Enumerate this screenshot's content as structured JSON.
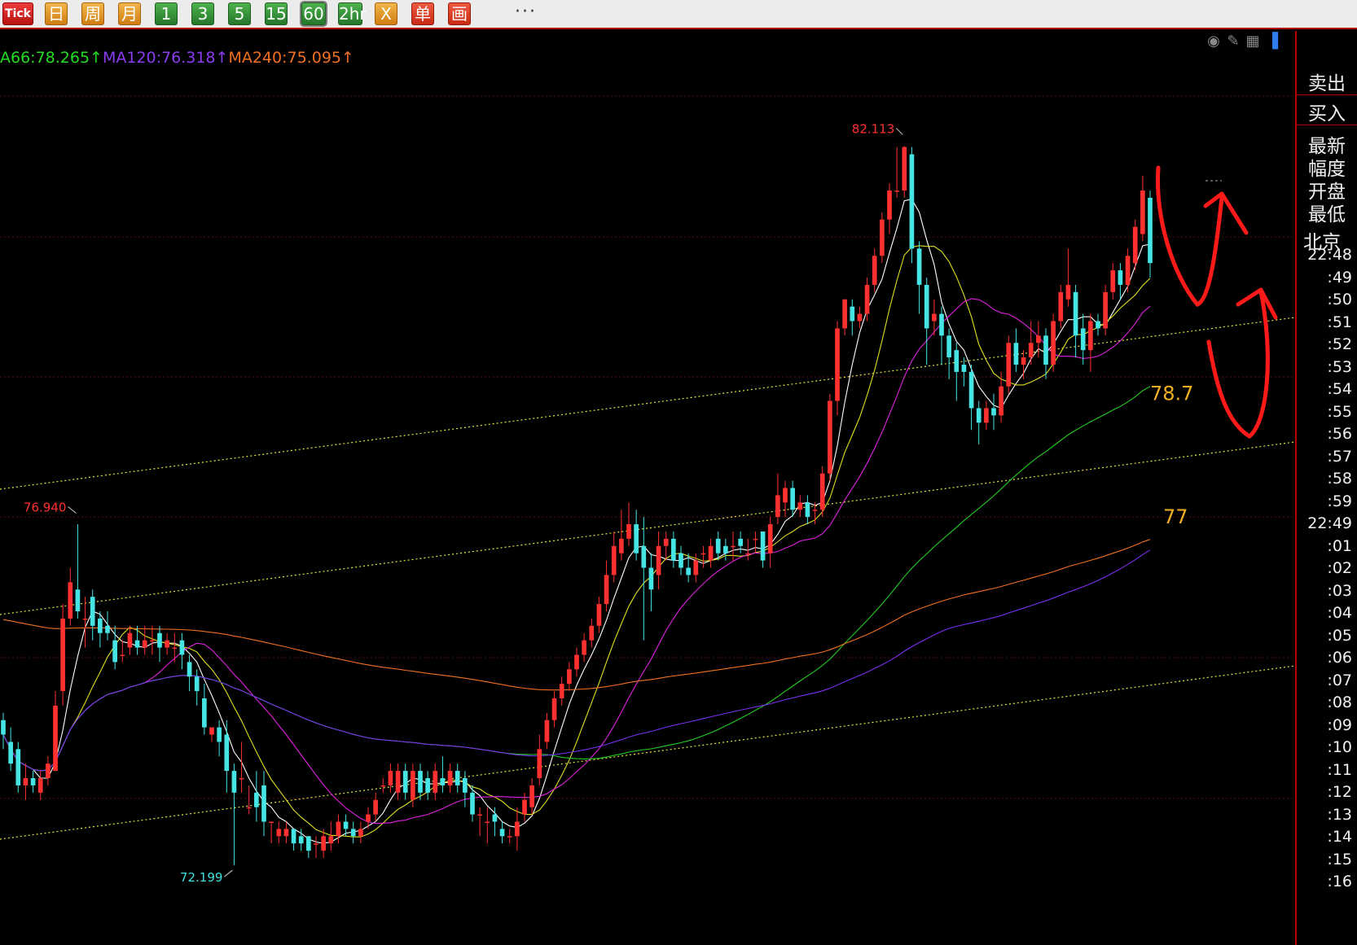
{
  "toolbar": {
    "buttons": [
      {
        "label": "Tick",
        "style": "tick"
      },
      {
        "label": "日",
        "style": "gold"
      },
      {
        "label": "周",
        "style": "gold"
      },
      {
        "label": "月",
        "style": "gold"
      },
      {
        "label": "1",
        "style": "green"
      },
      {
        "label": "3",
        "style": "green"
      },
      {
        "label": "5",
        "style": "green"
      },
      {
        "label": "15",
        "style": "green"
      },
      {
        "label": "60",
        "style": "green-selected"
      },
      {
        "label": "2hr",
        "style": "green"
      },
      {
        "label": "X",
        "style": "gold"
      },
      {
        "label": "单",
        "style": "red"
      },
      {
        "label": "画",
        "style": "red"
      }
    ],
    "more_label": "···"
  },
  "ma_legend": {
    "ma66": {
      "text": "A66:78.265↑",
      "color": "#22dd22"
    },
    "ma120": {
      "text": "MA120:76.318↑",
      "color": "#8a3cf0"
    },
    "ma240": {
      "text": "MA240:75.095↑",
      "color": "#f07020"
    }
  },
  "chart_data": {
    "type": "candlestick",
    "price_range": [
      71.1,
      83.7
    ],
    "annotations": [
      {
        "text": "82.113",
        "value": 82.113,
        "color": "#ff3030"
      },
      {
        "text": "76.940",
        "value": 76.94,
        "color": "#ff3030"
      },
      {
        "text": "72.199",
        "value": 72.199,
        "color": "#40e0e0"
      },
      {
        "text": "78.7",
        "value": 78.7,
        "color": "#f0b020"
      },
      {
        "text": "77",
        "value": 77,
        "color": "#f0b020"
      }
    ],
    "colors": {
      "up": "#ff3030",
      "down": "#45e5e5",
      "ma_fast": "#ffffff",
      "ma_mid": "#e0e020",
      "ma_slow": "#e020e0",
      "ma66": "#22cc22",
      "ma120": "#7a30f0",
      "ma240": "#f07020",
      "trend": "#e6e640",
      "hand_drawn": "#ff1a1a"
    },
    "candles": [
      [
        74.2,
        74.0,
        74.3,
        73.8
      ],
      [
        73.9,
        73.6,
        74.1,
        73.5
      ],
      [
        73.8,
        73.3,
        73.9,
        73.2
      ],
      [
        73.3,
        73.4,
        73.6,
        73.1
      ],
      [
        73.4,
        73.3,
        73.5,
        73.2
      ],
      [
        73.2,
        73.4,
        73.5,
        73.1
      ],
      [
        73.4,
        73.6,
        73.7,
        73.3
      ],
      [
        73.5,
        74.4,
        74.6,
        73.5
      ],
      [
        74.6,
        75.6,
        75.8,
        74.4
      ],
      [
        75.6,
        76.1,
        76.3,
        75.5
      ],
      [
        76.0,
        75.7,
        76.9,
        75.6
      ],
      [
        75.6,
        75.6,
        75.9,
        75.2
      ],
      [
        75.9,
        75.5,
        76.0,
        75.3
      ],
      [
        75.6,
        75.4,
        75.7,
        75.2
      ],
      [
        75.5,
        75.4,
        75.7,
        75.3
      ],
      [
        75.3,
        75.0,
        75.5,
        74.9
      ],
      [
        75.1,
        75.1,
        75.3,
        75.0
      ],
      [
        75.2,
        75.4,
        75.5,
        75.1
      ],
      [
        75.3,
        75.2,
        75.5,
        75.1
      ],
      [
        75.2,
        75.3,
        75.5,
        75.1
      ],
      [
        75.3,
        75.3,
        75.5,
        75.1
      ],
      [
        75.4,
        75.2,
        75.5,
        75.0
      ],
      [
        75.2,
        75.3,
        75.4,
        75.1
      ],
      [
        75.2,
        75.2,
        75.4,
        75.0
      ],
      [
        75.3,
        75.1,
        75.4,
        74.9
      ],
      [
        75.0,
        74.8,
        75.1,
        74.6
      ],
      [
        74.8,
        74.6,
        74.9,
        74.4
      ],
      [
        74.5,
        74.1,
        74.7,
        74.0
      ],
      [
        74.0,
        74.1,
        74.1,
        73.9
      ],
      [
        74.1,
        73.9,
        74.2,
        73.7
      ],
      [
        74.0,
        73.5,
        74.2,
        73.2
      ],
      [
        73.5,
        73.2,
        73.6,
        72.2
      ],
      [
        73.4,
        73.4,
        73.9,
        73.2
      ],
      [
        73.0,
        73.0,
        73.3,
        72.9
      ],
      [
        73.2,
        73.0,
        73.5,
        72.8
      ],
      [
        73.3,
        72.8,
        73.5,
        72.6
      ],
      [
        72.8,
        72.8,
        72.8,
        72.5
      ],
      [
        72.6,
        72.7,
        72.8,
        72.5
      ],
      [
        72.6,
        72.7,
        72.8,
        72.5
      ],
      [
        72.7,
        72.5,
        72.7,
        72.4
      ],
      [
        72.6,
        72.5,
        72.7,
        72.4
      ],
      [
        72.6,
        72.4,
        72.6,
        72.3
      ],
      [
        72.5,
        72.5,
        72.6,
        72.3
      ],
      [
        72.4,
        72.6,
        72.7,
        72.3
      ],
      [
        72.5,
        72.6,
        72.8,
        72.4
      ],
      [
        72.6,
        72.8,
        72.9,
        72.5
      ],
      [
        72.8,
        72.7,
        72.9,
        72.6
      ],
      [
        72.7,
        72.6,
        72.8,
        72.5
      ],
      [
        72.6,
        72.7,
        72.8,
        72.5
      ],
      [
        72.8,
        72.9,
        73.0,
        72.7
      ],
      [
        72.9,
        73.1,
        73.2,
        72.8
      ],
      [
        73.3,
        73.3,
        73.4,
        73.2
      ],
      [
        73.3,
        73.5,
        73.6,
        73.2
      ],
      [
        73.2,
        73.5,
        73.6,
        73.1
      ],
      [
        73.5,
        73.2,
        73.6,
        73.1
      ],
      [
        73.1,
        73.5,
        73.6,
        73.0
      ],
      [
        73.5,
        73.2,
        73.6,
        73.1
      ],
      [
        73.4,
        73.2,
        73.5,
        73.1
      ],
      [
        73.2,
        73.5,
        73.6,
        73.1
      ],
      [
        73.4,
        73.3,
        73.7,
        73.2
      ],
      [
        73.3,
        73.5,
        73.6,
        73.2
      ],
      [
        73.5,
        73.3,
        73.6,
        73.2
      ],
      [
        73.4,
        73.2,
        73.5,
        73.0
      ],
      [
        73.2,
        72.9,
        73.3,
        72.8
      ],
      [
        72.9,
        72.9,
        73.0,
        72.6
      ],
      [
        72.8,
        72.8,
        73.0,
        72.5
      ],
      [
        72.9,
        72.8,
        73.0,
        72.6
      ],
      [
        72.7,
        72.6,
        72.8,
        72.5
      ],
      [
        72.6,
        72.6,
        72.7,
        72.5
      ],
      [
        72.6,
        72.8,
        73.0,
        72.4
      ],
      [
        72.9,
        73.1,
        73.2,
        72.8
      ],
      [
        73.0,
        73.3,
        73.4,
        72.9
      ],
      [
        73.4,
        73.8,
        74.0,
        73.3
      ],
      [
        73.9,
        74.2,
        74.3,
        73.8
      ],
      [
        74.2,
        74.5,
        74.6,
        74.1
      ],
      [
        74.5,
        74.7,
        74.8,
        74.4
      ],
      [
        74.7,
        74.9,
        75.0,
        74.6
      ],
      [
        74.9,
        75.1,
        75.2,
        74.8
      ],
      [
        75.1,
        75.3,
        75.4,
        75.0
      ],
      [
        75.3,
        75.5,
        75.6,
        75.2
      ],
      [
        75.5,
        75.8,
        75.9,
        75.4
      ],
      [
        75.8,
        76.2,
        76.4,
        75.7
      ],
      [
        76.2,
        76.6,
        76.8,
        76.1
      ],
      [
        76.5,
        76.7,
        77.1,
        76.4
      ],
      [
        76.7,
        76.9,
        77.2,
        76.6
      ],
      [
        76.9,
        76.5,
        77.1,
        76.4
      ],
      [
        76.6,
        76.3,
        77.0,
        75.3
      ],
      [
        76.3,
        76.0,
        76.5,
        75.7
      ],
      [
        76.2,
        76.6,
        76.8,
        76.0
      ],
      [
        76.6,
        76.7,
        76.8,
        76.4
      ],
      [
        76.7,
        76.4,
        76.8,
        76.3
      ],
      [
        76.5,
        76.3,
        76.6,
        76.2
      ],
      [
        76.3,
        76.2,
        76.5,
        76.1
      ],
      [
        76.2,
        76.4,
        76.5,
        76.1
      ],
      [
        76.5,
        76.5,
        76.6,
        76.3
      ],
      [
        76.4,
        76.6,
        76.7,
        76.3
      ],
      [
        76.7,
        76.5,
        76.8,
        76.4
      ],
      [
        76.6,
        76.5,
        76.7,
        76.4
      ],
      [
        76.6,
        76.6,
        76.8,
        76.4
      ],
      [
        76.7,
        76.6,
        76.8,
        76.5
      ],
      [
        76.5,
        76.5,
        76.7,
        76.4
      ],
      [
        76.7,
        76.7,
        76.8,
        76.5
      ],
      [
        76.8,
        76.4,
        76.8,
        76.3
      ],
      [
        76.5,
        76.9,
        77.0,
        76.3
      ],
      [
        77.0,
        77.3,
        77.6,
        76.9
      ],
      [
        77.2,
        77.4,
        77.5,
        77.0
      ],
      [
        77.4,
        77.1,
        77.5,
        77.0
      ],
      [
        77.1,
        77.2,
        77.3,
        77.0
      ],
      [
        77.2,
        77.0,
        77.3,
        76.9
      ],
      [
        77.1,
        77.1,
        77.2,
        76.9
      ],
      [
        77.1,
        77.6,
        77.7,
        77.0
      ],
      [
        77.6,
        78.6,
        78.7,
        77.5
      ],
      [
        78.6,
        79.6,
        79.7,
        78.4
      ],
      [
        79.6,
        80.0,
        80.0,
        79.5
      ],
      [
        79.9,
        79.7,
        80.0,
        79.5
      ],
      [
        79.7,
        79.8,
        79.9,
        79.6
      ],
      [
        79.8,
        80.2,
        80.3,
        79.7
      ],
      [
        80.2,
        80.6,
        80.7,
        80.1
      ],
      [
        80.6,
        81.1,
        81.2,
        80.5
      ],
      [
        81.1,
        81.5,
        81.6,
        80.9
      ],
      [
        81.5,
        81.5,
        82.1,
        81.4
      ],
      [
        81.5,
        82.1,
        82.113,
        81.4
      ],
      [
        82.0,
        80.7,
        82.1,
        80.5
      ],
      [
        80.7,
        80.2,
        80.8,
        79.8
      ],
      [
        80.2,
        79.6,
        80.3,
        79.1
      ],
      [
        79.7,
        79.8,
        80.0,
        79.5
      ],
      [
        79.8,
        79.5,
        79.9,
        79.1
      ],
      [
        79.5,
        79.2,
        79.6,
        78.9
      ],
      [
        79.3,
        79.0,
        79.4,
        78.6
      ],
      [
        79.1,
        79.0,
        79.2,
        78.8
      ],
      [
        79.0,
        78.5,
        79.1,
        78.2
      ],
      [
        78.5,
        78.3,
        78.6,
        78.0
      ],
      [
        78.3,
        78.5,
        78.6,
        78.2
      ],
      [
        78.5,
        78.4,
        78.7,
        78.2
      ],
      [
        78.4,
        78.8,
        79.0,
        78.3
      ],
      [
        78.8,
        79.4,
        79.5,
        78.7
      ],
      [
        79.4,
        79.1,
        79.6,
        79.0
      ],
      [
        79.1,
        79.2,
        79.3,
        78.9
      ],
      [
        79.2,
        79.4,
        79.7,
        79.1
      ],
      [
        79.4,
        79.5,
        79.7,
        79.2
      ],
      [
        79.5,
        79.1,
        79.6,
        78.9
      ],
      [
        79.1,
        79.7,
        79.8,
        79.0
      ],
      [
        79.7,
        80.1,
        80.2,
        79.6
      ],
      [
        80.0,
        80.2,
        80.7,
        79.9
      ],
      [
        80.1,
        79.5,
        80.2,
        79.2
      ],
      [
        79.6,
        79.3,
        79.8,
        79.1
      ],
      [
        79.3,
        79.7,
        79.8,
        79.0
      ],
      [
        79.7,
        79.6,
        79.8,
        79.5
      ],
      [
        79.6,
        80.1,
        80.2,
        79.5
      ],
      [
        80.1,
        80.4,
        80.5,
        80.0
      ],
      [
        80.4,
        80.2,
        80.5,
        80.0
      ],
      [
        80.2,
        80.6,
        80.7,
        80.1
      ],
      [
        80.5,
        81.0,
        81.1,
        80.4
      ],
      [
        80.9,
        81.5,
        81.7,
        80.8
      ],
      [
        81.4,
        80.5,
        81.5,
        80.3
      ]
    ]
  },
  "side_panel": {
    "sell_label": "卖出",
    "buy_label": "买入",
    "quote_labels": [
      "最新",
      "幅度",
      "开盘",
      "最低"
    ],
    "region_label": "北京",
    "times": [
      "22:48",
      ":49",
      ":50",
      ":51",
      ":52",
      ":53",
      ":54",
      ":55",
      ":56",
      ":57",
      ":58",
      ":59",
      "22:49",
      ":01",
      ":02",
      ":03",
      ":04",
      ":05",
      ":06",
      ":07",
      ":08",
      ":09",
      ":10",
      ":11",
      ":12",
      ":13",
      ":14",
      ":15",
      ":16"
    ]
  }
}
